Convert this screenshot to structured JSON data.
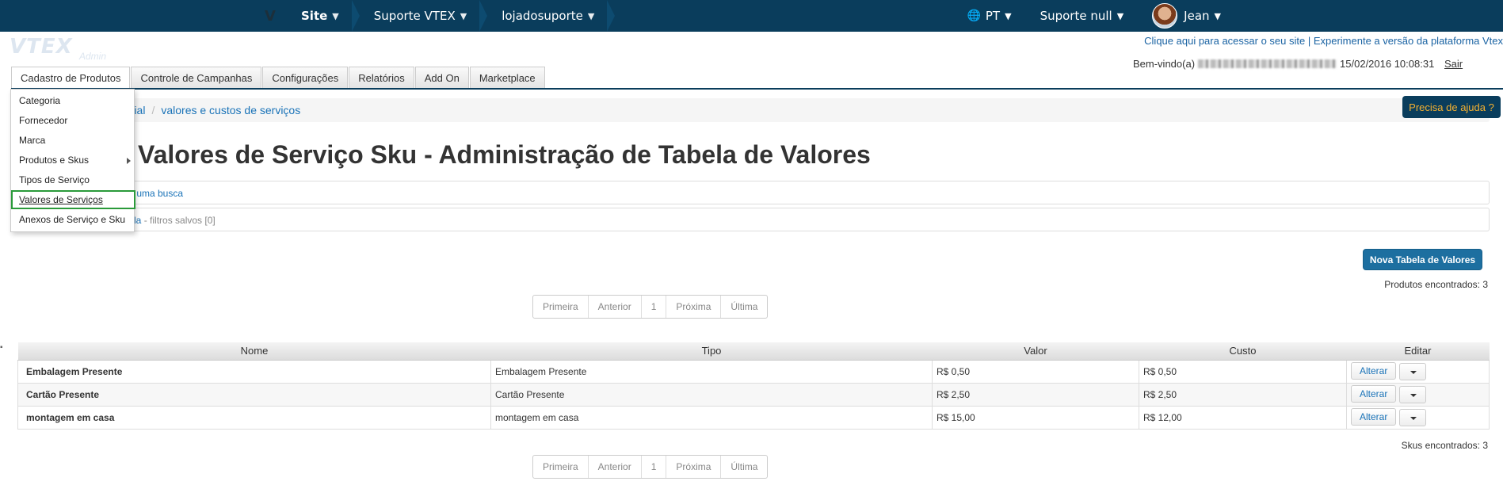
{
  "topbar": {
    "logo": "V",
    "breadcrumbs": [
      "Site",
      "Suporte VTEX",
      "lojadosuporte"
    ],
    "language": "PT",
    "account": "Suporte null",
    "user": "Jean"
  },
  "header": {
    "logo_text": "VTEX",
    "logo_sub": "Admin",
    "site_links": "Clique aqui para acessar o seu site | Experimente a versão da plataforma Vtex",
    "welcome_prefix": "Bem-vindo(a)",
    "welcome_datetime": "15/02/2016 10:08:31",
    "logout": "Sair"
  },
  "tabs": [
    "Cadastro de Produtos",
    "Controle de Campanhas",
    "Configurações",
    "Relatórios",
    "Add On",
    "Marketplace"
  ],
  "dropdown": {
    "items": [
      "Categoria",
      "Fornecedor",
      "Marca",
      "Produtos e Skus",
      "Tipos de Serviço",
      "Valores de Serviços",
      "Anexos de Serviço e Sku"
    ]
  },
  "breadcrumb": {
    "item1": "ercial",
    "item2": "valores e custos de serviços"
  },
  "help_button": "Precisa de ajuda ?",
  "page_title": "Valores de Serviço Sku - Administração de Tabela de Valores",
  "search_box": {
    "link": "r uma busca"
  },
  "saved_box": {
    "link": "da",
    "filters": " - filtros salvos [0]"
  },
  "new_button": "Nova Tabela de Valores",
  "products_found": "Produtos encontrados: 3",
  "skus_found": "Skus encontrados: 3",
  "pager": {
    "first": "Primeira",
    "prev": "Anterior",
    "page": "1",
    "next": "Próxima",
    "last": "Última"
  },
  "table": {
    "headers": [
      "Nome",
      "Tipo",
      "Valor",
      "Custo",
      "Editar"
    ],
    "rows": [
      {
        "nome": "Embalagem Presente",
        "tipo": "Embalagem Presente",
        "valor": "R$ 0,50",
        "custo": "R$ 0,50",
        "edit": "Alterar"
      },
      {
        "nome": "Cartão Presente",
        "tipo": "Cartão Presente",
        "valor": "R$ 2,50",
        "custo": "R$ 2,50",
        "edit": "Alterar"
      },
      {
        "nome": "montagem em casa",
        "tipo": "montagem em casa",
        "valor": "R$ 15,00",
        "custo": "R$ 12,00",
        "edit": "Alterar"
      }
    ]
  }
}
